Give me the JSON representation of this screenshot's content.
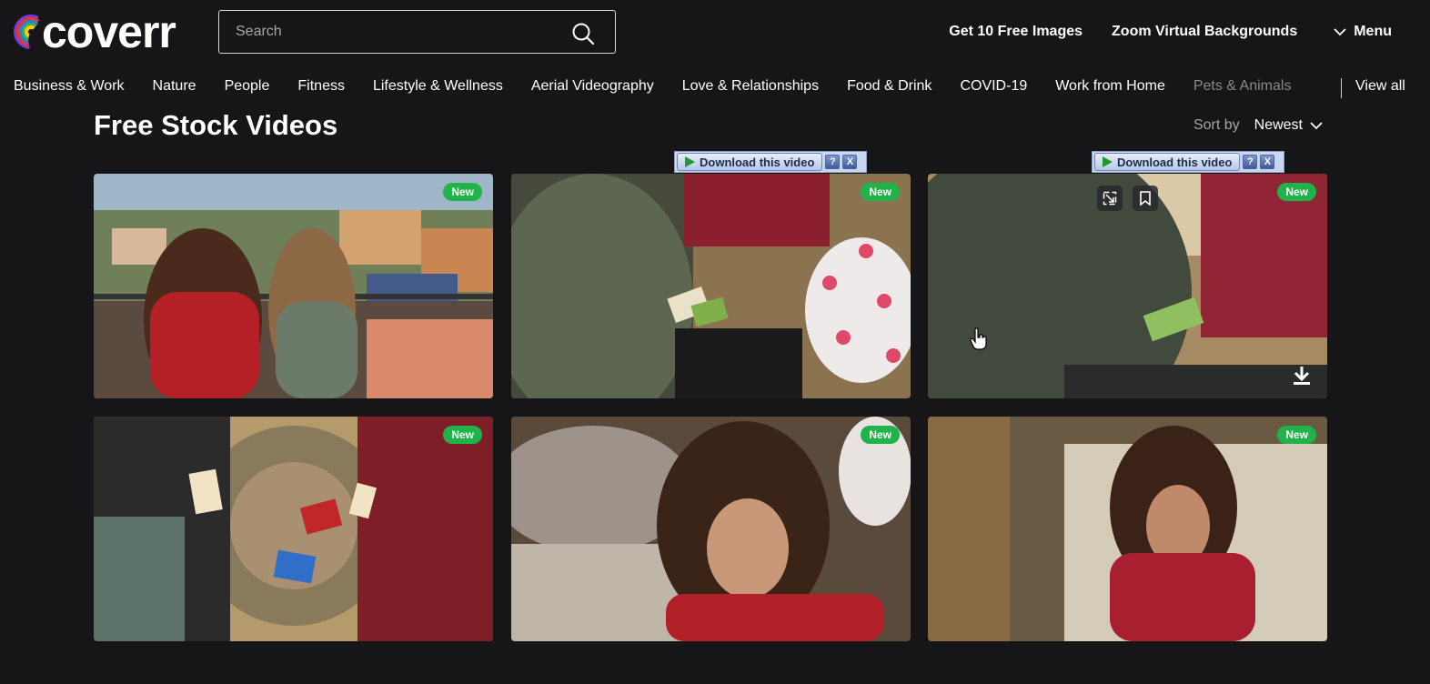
{
  "brand": {
    "name": "coverr",
    "ring_colors": [
      "#ffc61a",
      "#36b549",
      "#2f7bd6",
      "#e5372b",
      "#7a3bd6"
    ]
  },
  "search": {
    "placeholder": "Search"
  },
  "top_nav": {
    "links": [
      "Get 10 Free Images",
      "Zoom Virtual Backgrounds"
    ],
    "menu_label": "Menu"
  },
  "categories": [
    "Business & Work",
    "Nature",
    "People",
    "Fitness",
    "Lifestyle & Wellness",
    "Aerial Videography",
    "Love & Relationships",
    "Food & Drink",
    "COVID-19",
    "Work from Home",
    "Pets & Animals"
  ],
  "view_all": "View all",
  "page_title": "Free Stock Videos",
  "sort": {
    "label": "Sort by",
    "value": "Newest"
  },
  "download_toolbar": {
    "label": "Download this video",
    "help": "?",
    "close": "X"
  },
  "videos": [
    {
      "badge": "New",
      "scene": "two-girls-balcony"
    },
    {
      "badge": "New",
      "scene": "uno-cards-balloon"
    },
    {
      "badge": "New",
      "scene": "playing-cards-closeup",
      "hovered": true
    },
    {
      "badge": "New",
      "scene": "hands-uno-cards"
    },
    {
      "badge": "New",
      "scene": "woman-red-sweater"
    },
    {
      "badge": "New",
      "scene": "woman-sofa-cards"
    }
  ],
  "colors": {
    "background": "#161619",
    "badge_green": "#20b34a",
    "text": "#ffffff"
  }
}
